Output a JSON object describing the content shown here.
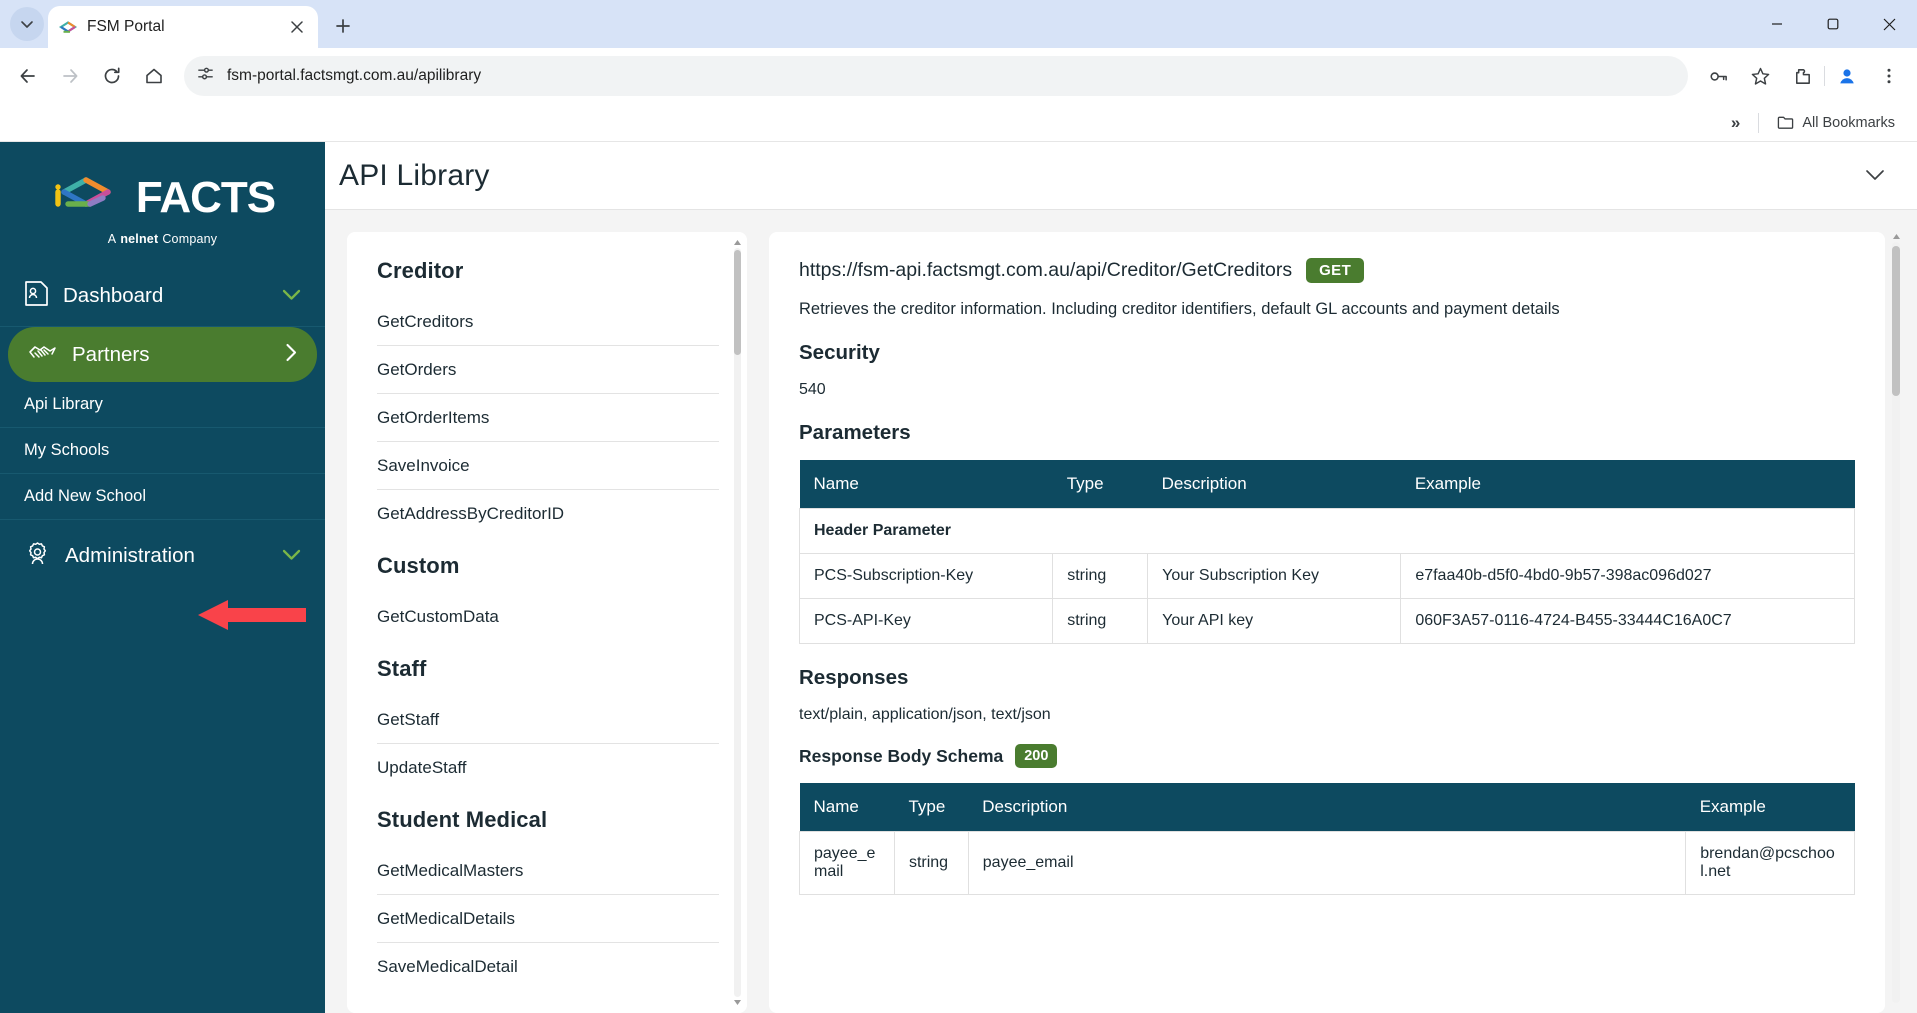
{
  "browser": {
    "tab": {
      "title": "FSM Portal",
      "favicon": "facts-logo-icon"
    },
    "new_tab_label": "+",
    "url": "fsm-portal.factsmgt.com.au/apilibrary",
    "bookmarks": {
      "overflow": "»",
      "all_bookmarks": "All Bookmarks"
    },
    "window": {
      "minimize": "–",
      "maximize": "❐",
      "close": "✕"
    }
  },
  "sidebar": {
    "logo": {
      "wordmark": "FACTS",
      "tagline_pre": "A",
      "tagline_brand": "nelnet",
      "tagline_post": "Company"
    },
    "nav": [
      {
        "label": "Dashboard",
        "icon": "id-card-icon",
        "chevron": "chevron-down",
        "active": false
      },
      {
        "label": "Partners",
        "icon": "handshake-icon",
        "chevron": "chevron-right",
        "active": true
      }
    ],
    "sub_items": [
      {
        "label": "Api Library"
      },
      {
        "label": "My Schools"
      },
      {
        "label": "Add New School"
      }
    ],
    "admin": {
      "label": "Administration",
      "icon": "gear-user-icon",
      "chevron": "chevron-down"
    }
  },
  "header": {
    "title": "API Library",
    "collapse_chevron": "chevron-down"
  },
  "endpoint_list": {
    "groups": [
      {
        "name": "Creditor",
        "endpoints": [
          "GetCreditors",
          "GetOrders",
          "GetOrderItems",
          "SaveInvoice",
          "GetAddressByCreditorID"
        ]
      },
      {
        "name": "Custom",
        "endpoints": [
          "GetCustomData"
        ]
      },
      {
        "name": "Staff",
        "endpoints": [
          "GetStaff",
          "UpdateStaff"
        ]
      },
      {
        "name": "Student Medical",
        "endpoints": [
          "GetMedicalMasters",
          "GetMedicalDetails",
          "SaveMedicalDetail"
        ]
      }
    ]
  },
  "detail": {
    "url": "https://fsm-api.factsmgt.com.au/api/Creditor/GetCreditors",
    "method": "GET",
    "description": "Retrieves the creditor information. Including creditor identifiers, default GL accounts and payment details",
    "security": {
      "heading": "Security",
      "value": "540"
    },
    "parameters": {
      "heading": "Parameters",
      "columns": [
        "Name",
        "Type",
        "Description",
        "Example"
      ],
      "group_row": "Header Parameter",
      "rows": [
        {
          "name": "PCS-Subscription-Key",
          "type": "string",
          "description": "Your Subscription Key",
          "example": "e7faa40b-d5f0-4bd0-9b57-398ac096d027"
        },
        {
          "name": "PCS-API-Key",
          "type": "string",
          "description": "Your API key",
          "example": "060F3A57-0116-4724-B455-33444C16A0C7"
        }
      ]
    },
    "responses": {
      "heading": "Responses",
      "content_types": "text/plain, application/json, text/json",
      "schema_label": "Response Body Schema",
      "status_code": "200",
      "columns": [
        "Name",
        "Type",
        "Description",
        "Example"
      ],
      "rows": [
        {
          "name": "payee_email",
          "type": "string",
          "description": "payee_email",
          "example": "brendan@pcschool.net"
        }
      ]
    }
  },
  "colors": {
    "sidebar_bg": "#0d4a60",
    "accent_green": "#4a7c2f",
    "chevron_green": "#7ab648",
    "table_header": "#0d4a60",
    "annotation_red": "#f9434a"
  }
}
